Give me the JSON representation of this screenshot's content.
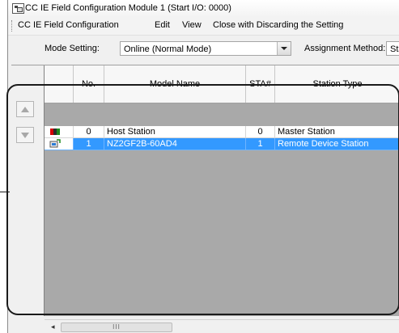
{
  "window": {
    "title": "CC IE Field Configuration Module 1 (Start I/O: 0000)"
  },
  "menu": {
    "items": [
      "CC IE Field Configuration",
      "Edit",
      "View",
      "Close with Discarding the Setting"
    ]
  },
  "mode": {
    "label": "Mode Setting:",
    "value": "Online (Normal Mode)",
    "assignment_label": "Assignment Method:",
    "assignment_value": "Sta"
  },
  "table": {
    "headers": [
      "No.",
      "Model Name",
      "STA#",
      "Station Type"
    ],
    "rows": [
      {
        "icon": "host-station-icon",
        "no": "0",
        "model": "Host Station",
        "sta": "0",
        "type": "Master Station",
        "selected": false
      },
      {
        "icon": "remote-device-icon",
        "no": "1",
        "model": "NZ2GF2B-60AD4",
        "sta": "1",
        "type": "Remote Device Station",
        "selected": true
      }
    ]
  },
  "scrollbar": {
    "left_arrow": "◂",
    "thumb_grip": "III"
  },
  "colors": {
    "selection": "#3399ff",
    "empty_grid": "#a9a9a9",
    "background": "#f0f0f0"
  }
}
